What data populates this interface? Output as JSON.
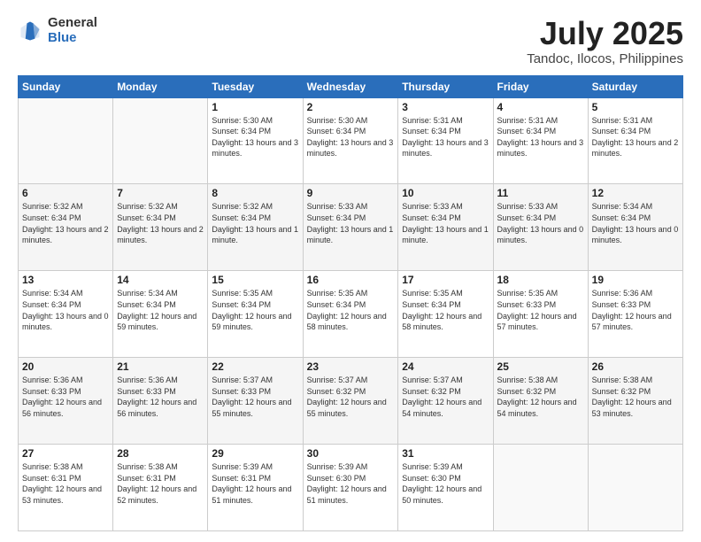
{
  "logo": {
    "general": "General",
    "blue": "Blue"
  },
  "header": {
    "title": "July 2025",
    "subtitle": "Tandoc, Ilocos, Philippines"
  },
  "days_of_week": [
    "Sunday",
    "Monday",
    "Tuesday",
    "Wednesday",
    "Thursday",
    "Friday",
    "Saturday"
  ],
  "weeks": [
    [
      {
        "day": "",
        "info": ""
      },
      {
        "day": "",
        "info": ""
      },
      {
        "day": "1",
        "info": "Sunrise: 5:30 AM\nSunset: 6:34 PM\nDaylight: 13 hours\nand 3 minutes."
      },
      {
        "day": "2",
        "info": "Sunrise: 5:30 AM\nSunset: 6:34 PM\nDaylight: 13 hours\nand 3 minutes."
      },
      {
        "day": "3",
        "info": "Sunrise: 5:31 AM\nSunset: 6:34 PM\nDaylight: 13 hours\nand 3 minutes."
      },
      {
        "day": "4",
        "info": "Sunrise: 5:31 AM\nSunset: 6:34 PM\nDaylight: 13 hours\nand 3 minutes."
      },
      {
        "day": "5",
        "info": "Sunrise: 5:31 AM\nSunset: 6:34 PM\nDaylight: 13 hours\nand 2 minutes."
      }
    ],
    [
      {
        "day": "6",
        "info": "Sunrise: 5:32 AM\nSunset: 6:34 PM\nDaylight: 13 hours\nand 2 minutes."
      },
      {
        "day": "7",
        "info": "Sunrise: 5:32 AM\nSunset: 6:34 PM\nDaylight: 13 hours\nand 2 minutes."
      },
      {
        "day": "8",
        "info": "Sunrise: 5:32 AM\nSunset: 6:34 PM\nDaylight: 13 hours\nand 1 minute."
      },
      {
        "day": "9",
        "info": "Sunrise: 5:33 AM\nSunset: 6:34 PM\nDaylight: 13 hours\nand 1 minute."
      },
      {
        "day": "10",
        "info": "Sunrise: 5:33 AM\nSunset: 6:34 PM\nDaylight: 13 hours\nand 1 minute."
      },
      {
        "day": "11",
        "info": "Sunrise: 5:33 AM\nSunset: 6:34 PM\nDaylight: 13 hours\nand 0 minutes."
      },
      {
        "day": "12",
        "info": "Sunrise: 5:34 AM\nSunset: 6:34 PM\nDaylight: 13 hours\nand 0 minutes."
      }
    ],
    [
      {
        "day": "13",
        "info": "Sunrise: 5:34 AM\nSunset: 6:34 PM\nDaylight: 13 hours\nand 0 minutes."
      },
      {
        "day": "14",
        "info": "Sunrise: 5:34 AM\nSunset: 6:34 PM\nDaylight: 12 hours\nand 59 minutes."
      },
      {
        "day": "15",
        "info": "Sunrise: 5:35 AM\nSunset: 6:34 PM\nDaylight: 12 hours\nand 59 minutes."
      },
      {
        "day": "16",
        "info": "Sunrise: 5:35 AM\nSunset: 6:34 PM\nDaylight: 12 hours\nand 58 minutes."
      },
      {
        "day": "17",
        "info": "Sunrise: 5:35 AM\nSunset: 6:34 PM\nDaylight: 12 hours\nand 58 minutes."
      },
      {
        "day": "18",
        "info": "Sunrise: 5:35 AM\nSunset: 6:33 PM\nDaylight: 12 hours\nand 57 minutes."
      },
      {
        "day": "19",
        "info": "Sunrise: 5:36 AM\nSunset: 6:33 PM\nDaylight: 12 hours\nand 57 minutes."
      }
    ],
    [
      {
        "day": "20",
        "info": "Sunrise: 5:36 AM\nSunset: 6:33 PM\nDaylight: 12 hours\nand 56 minutes."
      },
      {
        "day": "21",
        "info": "Sunrise: 5:36 AM\nSunset: 6:33 PM\nDaylight: 12 hours\nand 56 minutes."
      },
      {
        "day": "22",
        "info": "Sunrise: 5:37 AM\nSunset: 6:33 PM\nDaylight: 12 hours\nand 55 minutes."
      },
      {
        "day": "23",
        "info": "Sunrise: 5:37 AM\nSunset: 6:32 PM\nDaylight: 12 hours\nand 55 minutes."
      },
      {
        "day": "24",
        "info": "Sunrise: 5:37 AM\nSunset: 6:32 PM\nDaylight: 12 hours\nand 54 minutes."
      },
      {
        "day": "25",
        "info": "Sunrise: 5:38 AM\nSunset: 6:32 PM\nDaylight: 12 hours\nand 54 minutes."
      },
      {
        "day": "26",
        "info": "Sunrise: 5:38 AM\nSunset: 6:32 PM\nDaylight: 12 hours\nand 53 minutes."
      }
    ],
    [
      {
        "day": "27",
        "info": "Sunrise: 5:38 AM\nSunset: 6:31 PM\nDaylight: 12 hours\nand 53 minutes."
      },
      {
        "day": "28",
        "info": "Sunrise: 5:38 AM\nSunset: 6:31 PM\nDaylight: 12 hours\nand 52 minutes."
      },
      {
        "day": "29",
        "info": "Sunrise: 5:39 AM\nSunset: 6:31 PM\nDaylight: 12 hours\nand 51 minutes."
      },
      {
        "day": "30",
        "info": "Sunrise: 5:39 AM\nSunset: 6:30 PM\nDaylight: 12 hours\nand 51 minutes."
      },
      {
        "day": "31",
        "info": "Sunrise: 5:39 AM\nSunset: 6:30 PM\nDaylight: 12 hours\nand 50 minutes."
      },
      {
        "day": "",
        "info": ""
      },
      {
        "day": "",
        "info": ""
      }
    ]
  ]
}
